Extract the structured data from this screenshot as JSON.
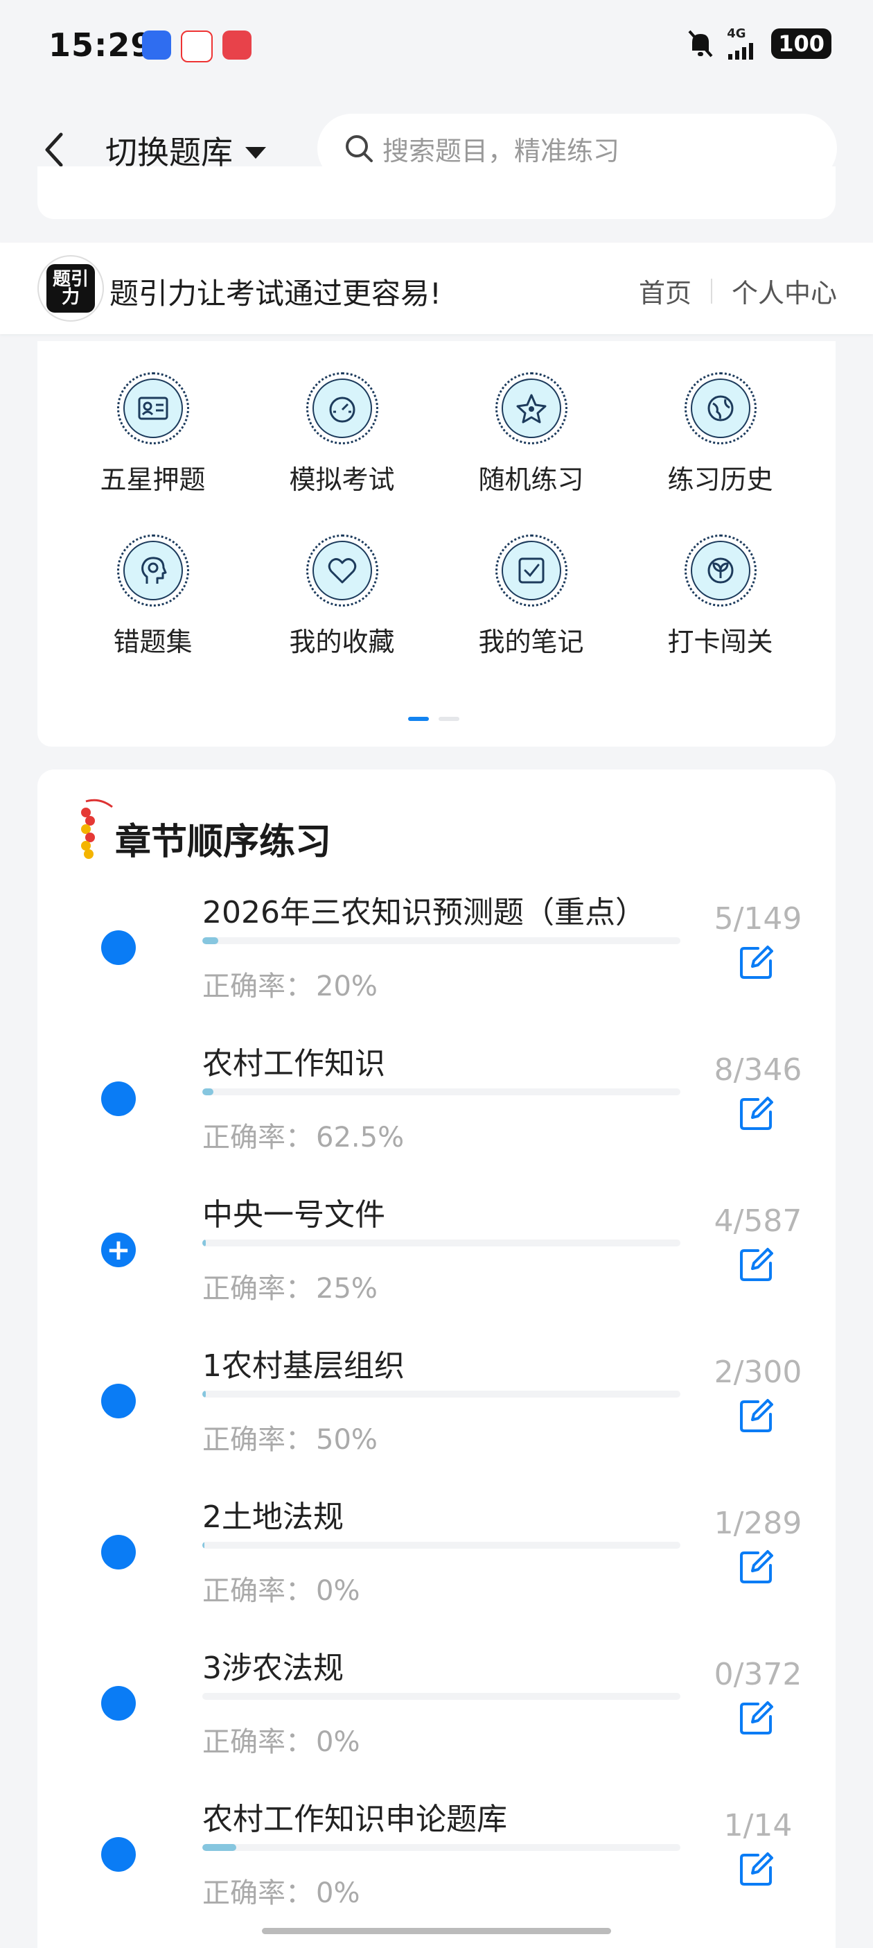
{
  "status_bar": {
    "time": "15:29",
    "network": "4G",
    "battery": "100"
  },
  "nav": {
    "switch_label": "切换题库",
    "search_placeholder": "搜索题目，精准练习"
  },
  "brand": {
    "logo_text": "题引力",
    "slogan": "题引力让考试通过更容易!",
    "links": [
      "首页",
      "个人中心"
    ]
  },
  "grid": [
    {
      "label": "五星押题",
      "icon": "id-card-icon"
    },
    {
      "label": "模拟考试",
      "icon": "speedometer-icon"
    },
    {
      "label": "随机练习",
      "icon": "star-shape-icon"
    },
    {
      "label": "练习历史",
      "icon": "globe-icon"
    },
    {
      "label": "错题集",
      "icon": "head-icon"
    },
    {
      "label": "我的收藏",
      "icon": "heart-icon"
    },
    {
      "label": "我的笔记",
      "icon": "checkbox-icon"
    },
    {
      "label": "打卡闯关",
      "icon": "sprout-icon"
    }
  ],
  "chapter": {
    "title": "章节顺序练习",
    "accuracy_label": "正确率：",
    "items": [
      {
        "name": "2026年三农知识预测题（重点）",
        "accuracy": "20%",
        "count": "5/149",
        "done": 5,
        "total": 149,
        "expanded": false
      },
      {
        "name": "农村工作知识",
        "accuracy": "62.5%",
        "count": "8/346",
        "done": 8,
        "total": 346,
        "expanded": false
      },
      {
        "name": "中央一号文件",
        "accuracy": "25%",
        "count": "4/587",
        "done": 4,
        "total": 587,
        "expanded": true
      },
      {
        "name": "1农村基层组织",
        "accuracy": "50%",
        "count": "2/300",
        "done": 2,
        "total": 300,
        "expanded": false
      },
      {
        "name": "2土地法规",
        "accuracy": "0%",
        "count": "1/289",
        "done": 1,
        "total": 289,
        "expanded": false
      },
      {
        "name": "3涉农法规",
        "accuracy": "0%",
        "count": "0/372",
        "done": 0,
        "total": 372,
        "expanded": false
      },
      {
        "name": "农村工作知识申论题库",
        "accuracy": "0%",
        "count": "1/14",
        "done": 1,
        "total": 14,
        "expanded": false
      }
    ]
  },
  "colors": {
    "accent": "#0a7cf5",
    "progress": "#86c6df",
    "icon_bg": "#d8f4fb"
  }
}
